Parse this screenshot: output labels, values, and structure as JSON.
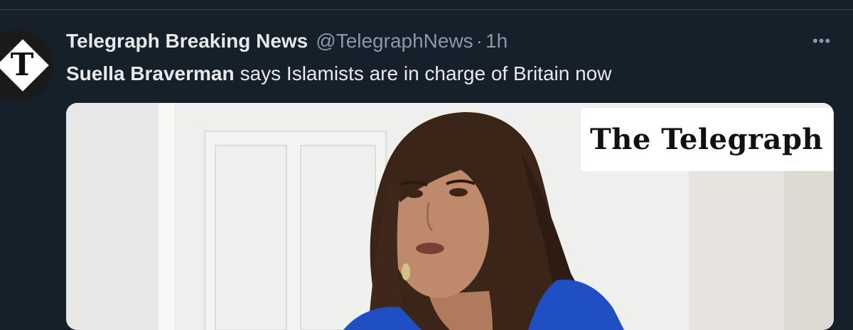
{
  "tweet": {
    "author": {
      "name": "Telegraph Breaking News",
      "handle": "@TelegraphNews",
      "avatar_glyph": "T",
      "avatar_icon": "telegraph-logo-icon"
    },
    "separator": "·",
    "time": "1h",
    "more_icon": "•••",
    "text": {
      "mention": "Suella Braverman",
      "body": "says Islamists are in charge of Britain now"
    },
    "media": {
      "brand_label": "The Telegraph"
    }
  },
  "colors": {
    "background": "#15202b",
    "divider": "#38444d",
    "primary_text": "#e7e9ea",
    "secondary_text": "#8b98a5",
    "blazer_blue": "#1f4fc2"
  }
}
